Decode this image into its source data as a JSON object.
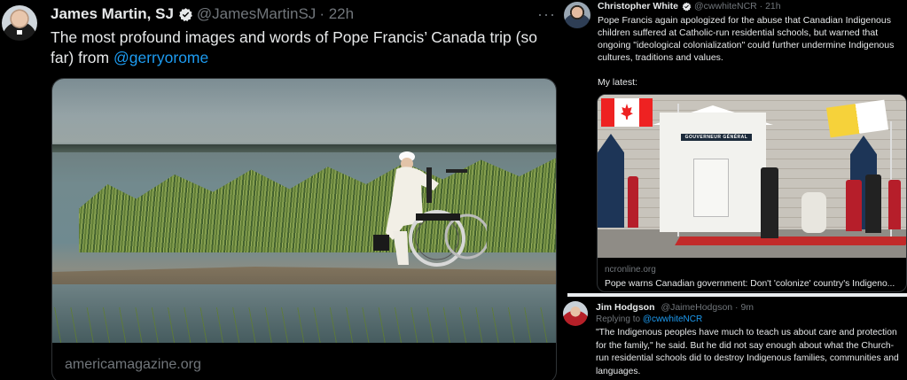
{
  "left_tweet": {
    "author_name": "James Martin, SJ",
    "handle": "@JamesMartinSJ",
    "time": "· 22h",
    "more": "···",
    "text": "The most profound images and words of Pope Francis’ Canada trip (so far) from",
    "mention": "@gerryorome",
    "card_domain": "americamagazine.org"
  },
  "right_tweet_1": {
    "author_name": "Christopher White",
    "handle": "@cwwhiteNCR · 21h",
    "text": "Pope Francis again apologized for the abuse that Canadian Indigenous children suffered at Catholic-run residential schools, but warned that ongoing \"ideological colonialization\" could further undermine Indigenous cultures, traditions and values.",
    "text2": "My latest:",
    "card_sign": "GOUVERNEUR GÉNÉRAL",
    "card_domain": "ncronline.org",
    "card_title": "Pope warns Canadian government: Don't 'colonize' country's Indigeno..."
  },
  "right_tweet_2": {
    "author_name": "Jim Hodgson",
    "handle": "@JaimeHodgson · 9m",
    "replying_prefix": "Replying to ",
    "replying_to": "@cwwhiteNCR",
    "text": "\"The Indigenous peoples have much to teach us about care and protection for the family,\" he said. But he did not say enough about what the Church-run residential schools did to destroy Indigenous families, communities and languages."
  },
  "icons": [
    "verified-badge-icon",
    "more-options-icon"
  ],
  "colors": {
    "background": "#000000",
    "text": "#e7e9ea",
    "muted": "#71767b",
    "link": "#1d9bf0",
    "verified": "#e7e9ea"
  }
}
